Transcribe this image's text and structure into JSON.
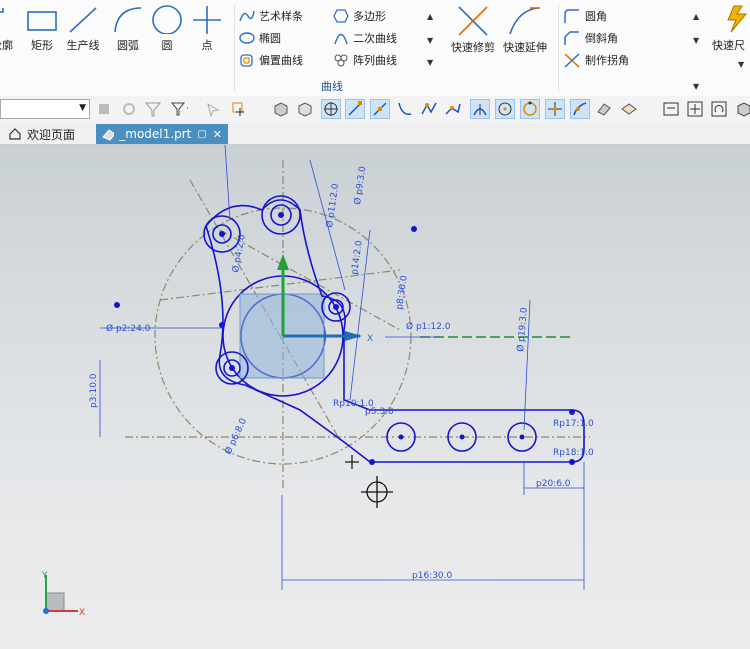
{
  "ribbon": {
    "big_buttons": [
      {
        "label": "轮廓",
        "icon": "profile-icon"
      },
      {
        "label": "矩形",
        "icon": "rectangle-icon"
      },
      {
        "label": "生产线",
        "icon": "line-icon"
      },
      {
        "label": "圆弧",
        "icon": "arc-icon"
      },
      {
        "label": "圆",
        "icon": "circle-icon"
      },
      {
        "label": "点",
        "icon": "point-icon"
      }
    ],
    "curve_group": {
      "col1": [
        "艺术样条",
        "椭圆",
        "偏置曲线"
      ],
      "col2": [
        "多边形",
        "二次曲线",
        "阵列曲线"
      ],
      "label": "曲线"
    },
    "edit_buttons": [
      {
        "label": "快速修剪",
        "icon": "quick-trim-icon"
      },
      {
        "label": "快速延伸",
        "icon": "quick-extend-icon"
      }
    ],
    "corner_group": [
      "圆角",
      "倒斜角",
      "制作拐角"
    ],
    "right_button": {
      "label": "快速尺",
      "icon": "rapid-dimension-icon"
    }
  },
  "toolbar": {
    "filter_value": ""
  },
  "tabs": [
    {
      "label": "欢迎页面",
      "active": false
    },
    {
      "label": "_model1.prt",
      "active": true
    }
  ],
  "dimensions": {
    "p2": "Ø p2:24.0",
    "p1": "Ø p1:12.0",
    "p11": "Ø p11:2.0",
    "p9": "Ø p9:3.0",
    "p3": "p3:10.0",
    "p8": "p8:30.0",
    "p19": "Ø p19:3.0",
    "p17": "Rp17:1.0",
    "p18": "Rp18:1.0",
    "p20": "p20:6.0",
    "p16": "p16:30.0",
    "p10": "Rp10:1.0",
    "p5": "p5:3.0",
    "p6": "Ø p6:8.0",
    "p14": "p14:2.0",
    "p4": "Ø p4:2.0"
  },
  "axis": {
    "x": "X",
    "y": "Y"
  },
  "colors": {
    "sketch": "#1515d0",
    "dimension": "#2b4fd6",
    "construction": "#8a8a6a",
    "accent": "#4a8fc0"
  }
}
